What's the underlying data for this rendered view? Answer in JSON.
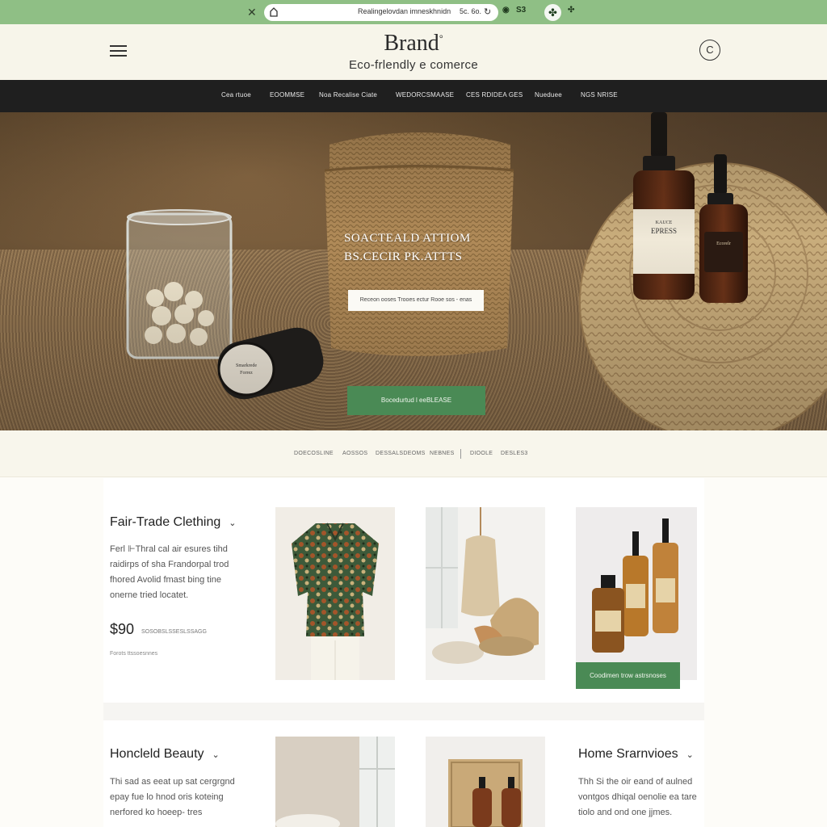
{
  "browser": {
    "url": "Realingelovdan imneskhnidn",
    "zoom": "5c. 6o.",
    "ext_label": "S3"
  },
  "header": {
    "brand": "Brand",
    "brand_mark": "°",
    "tagline": "Eco-frlendly e comerce",
    "user_icon_glyph": "C"
  },
  "nav": {
    "items": [
      "Cea rtuoe",
      "EOOMMSE",
      "Noa Recalise Ciate",
      "WEDORCSMAASE",
      "CES RDIDEA GES",
      "Nueduee",
      "NGS NRISE"
    ]
  },
  "hero": {
    "headline_line1": "SOACTEALD ATTIOM",
    "headline_line2": "BS.CECIR PK.ATTTS",
    "button_light": "Receon ooses Trooes ectur Rooe sos - enas",
    "button_green": "Bocedurtud l eeBLEASE"
  },
  "filters": {
    "items": [
      "DOECOSLINE",
      "AOSSOS",
      "DESSALSDEOMS",
      "NEBNES",
      "DIOOLE",
      "DESLES3"
    ]
  },
  "sections": {
    "clothing": {
      "title": "Fair-Trade Clething",
      "desc_lines": [
        "Ferl ⊩Thral cal air esures tihd",
        "raidirps of sha Frandorpal trod",
        "fhored Avolid fmast bing tine",
        "onerne tried locatet."
      ],
      "price": "$90",
      "price_sub": "SOSOBSLSSESLSSAGG",
      "meta": "Forots ttssoesnnes",
      "card_button": "Coodimen trow astrsnoses"
    },
    "beauty": {
      "title": "Honcleld Beauty",
      "desc_lines": [
        "Thi sad as eeat up sat cergrgnd",
        "epay fue lo hnod oris koteing",
        "nerfored ko hoeep- tres"
      ]
    },
    "home": {
      "title": "Home Srarnvioes",
      "desc_lines": [
        "Thh Si the oir eand of aulned",
        "vontgos dhiqal oenolie ea tare",
        "tiolo and ond one jjmes."
      ]
    }
  },
  "colors": {
    "browser_green": "#8fbf85",
    "header_cream": "#f7f5ea",
    "nav_black": "#1f1f1f",
    "accent_green": "#4a8a55"
  },
  "icons": {
    "menu": "hamburger-menu-icon",
    "user": "user-account-icon",
    "close": "close-tab-icon",
    "home": "home-icon",
    "reload": "reload-icon",
    "chevron": "chevron-down-icon"
  }
}
